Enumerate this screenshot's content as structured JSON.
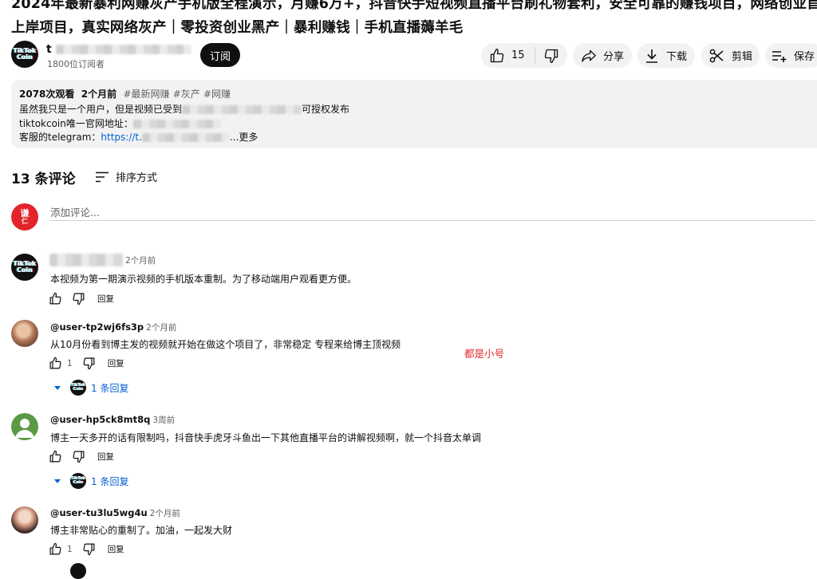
{
  "video": {
    "title_line1": "2024年最新暴利网赚灰产手机版全程演示，月赚6万+，抖音快手短视频直播平台刷礼物套利，安全可靠的赚钱项目，网络创业首选，",
    "title_line2": "上岸项目，真实网络灰产｜零投资创业黑产｜暴利赚钱｜手机直播薅羊毛"
  },
  "channel": {
    "name_prefix": "t",
    "subscribers": "1800位订阅者",
    "subscribe_label": "订阅",
    "logo_line1": "TikTok",
    "logo_line2": "Coin"
  },
  "actions": {
    "like_count": "15",
    "share_label": "分享",
    "download_label": "下载",
    "clip_label": "剪辑",
    "save_label": "保存"
  },
  "description": {
    "views": "2078次观看",
    "age": "2个月前",
    "tags": [
      "#最新网赚",
      "#灰产",
      "#网赚"
    ],
    "line1_start": "虽然我只是一个用户，但是视频已受到",
    "line1_end": "可授权发布",
    "line2_label": "tiktokcoin唯一官网地址：",
    "line3_label": "客服的telegram：",
    "line3_link_start": "https://t.",
    "more_label": "...更多"
  },
  "comments_header": {
    "count_label": "13 条评论",
    "sort_label": "排序方式"
  },
  "composer": {
    "avatar_line1": "谦",
    "avatar_line2": "仁",
    "placeholder": "添加评论..."
  },
  "comments": [
    {
      "author": "",
      "time": "2个月前",
      "text": "本视频为第一期演示视频的手机版本重制。为了移动端用户观看更方便。",
      "likes": "",
      "reply_label": "回复"
    },
    {
      "author": "@user-tp2wj6fs3p",
      "time": "2个月前",
      "text": "从10月份看到博主发的视频就开始在做这个项目了，非常稳定 专程来给博主顶视频",
      "likes": "1",
      "reply_label": "回复",
      "replies_label": "1 条回复"
    },
    {
      "author": "@user-hp5ck8mt8q",
      "time": "3周前",
      "text": "博主一天多开的话有限制吗，抖音快手虎牙斗鱼出一下其他直播平台的讲解视频啊，就一个抖音太单调",
      "likes": "",
      "reply_label": "回复",
      "replies_label": "1 条回复"
    },
    {
      "author": "@user-tu3lu5wg4u",
      "time": "2个月前",
      "text": "博主非常贴心的重制了。加油，一起发大财",
      "likes": "1",
      "reply_label": "回复"
    }
  ],
  "annotation": "都是小号",
  "colors": {
    "link": "#065fd4",
    "annotation": "#e4262b",
    "pill_bg": "#f2f2f2",
    "composer_avatar": "#e3242b"
  }
}
